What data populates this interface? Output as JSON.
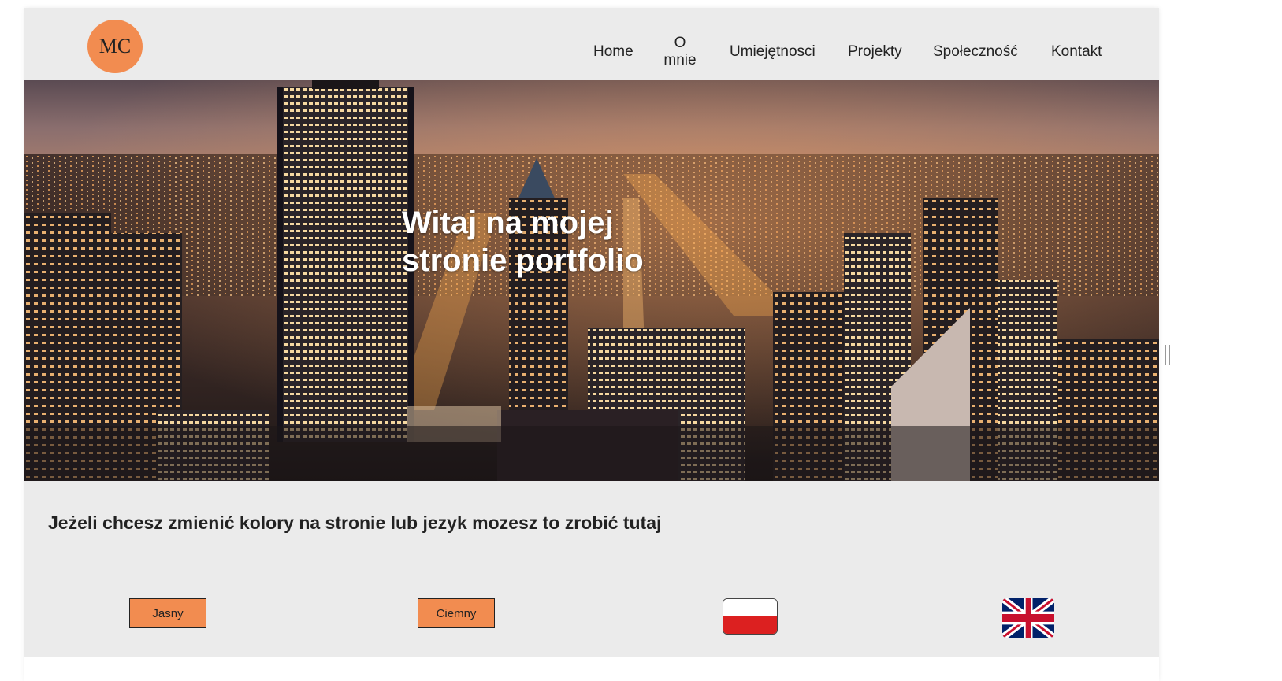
{
  "header": {
    "logo_text": "MC",
    "nav": {
      "home": "Home",
      "about_line1": "O",
      "about_line2": "mnie",
      "skills": "Umiejętnosci",
      "projects": "Projekty",
      "community": "Społeczność",
      "contact": "Kontakt"
    }
  },
  "hero": {
    "title_line1": "Witaj na mojej",
    "title_line2": "stronie portfolio"
  },
  "settings": {
    "heading": "Jeżeli chcesz zmienić kolory na stronie lub jezyk mozesz to zrobić tutaj",
    "light_label": "Jasny",
    "dark_label": "Ciemny",
    "language_options": [
      "pl-flag-icon",
      "uk-flag-icon"
    ]
  },
  "colors": {
    "accent": "#f28c50",
    "header_bg": "#ebebeb",
    "text": "#222222"
  }
}
